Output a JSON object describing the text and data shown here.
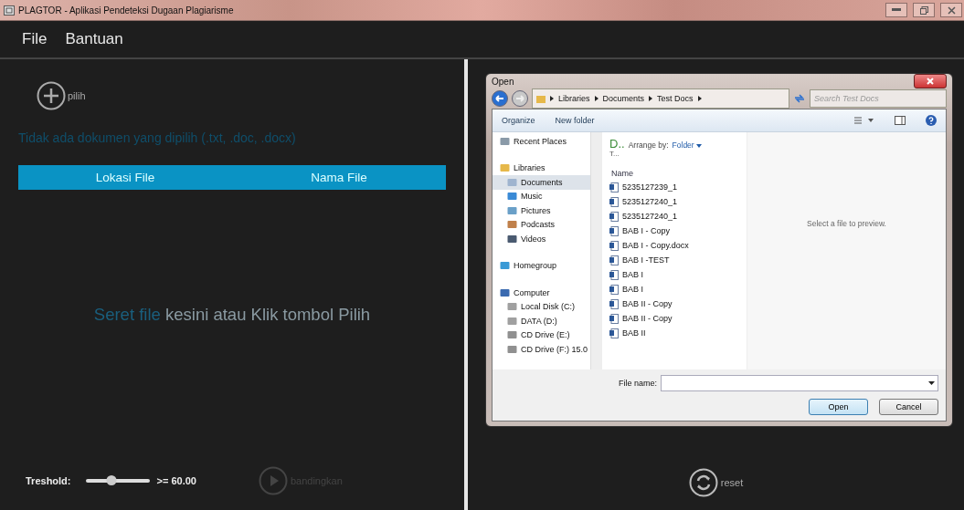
{
  "window": {
    "title": "PLAGTOR - Aplikasi Pendeteksi Dugaan Plagiarisme"
  },
  "menu": [
    "File",
    "Bantuan"
  ],
  "left": {
    "pick_label": "pilih",
    "status": "Tidak ada dokumen yang dipilih (.txt, .doc, .docx)",
    "columns": [
      "Lokasi File",
      "Nama File"
    ],
    "drop_hint": {
      "muted": "Seret file",
      "rest_1": "kesini",
      "rest_2": "atau Klik tombol Pilih"
    },
    "threshold": {
      "label": "Treshold:",
      "level": 0.4,
      "reading": ">= 60.00"
    },
    "compare": {
      "label": "bandingkan",
      "disabled": true
    }
  },
  "right": {
    "reset": {
      "label": "reset"
    }
  },
  "dialog": {
    "title": "Open",
    "path": [
      "Libraries",
      "Documents",
      "Test Docs"
    ],
    "search": {
      "placeholder": "Search Test Docs"
    },
    "toolbar": [
      "Organize",
      "New folder"
    ],
    "nav": [
      {
        "label": "Recent Places",
        "kind": "recent",
        "selected": false
      },
      {
        "label": "Libraries",
        "kind": "libraries",
        "selected": false,
        "children": [
          {
            "label": "Documents",
            "kind": "documents",
            "selected": true
          },
          {
            "label": "Music",
            "kind": "music",
            "selected": false
          },
          {
            "label": "Pictures",
            "kind": "pictures",
            "selected": false
          },
          {
            "label": "Podcasts",
            "kind": "podcasts",
            "selected": false
          },
          {
            "label": "Videos",
            "kind": "videos",
            "selected": false
          }
        ]
      },
      {
        "label": "Homegroup",
        "kind": "homegroup",
        "selected": false
      },
      {
        "label": "Computer",
        "kind": "computer",
        "selected": false,
        "children": [
          {
            "label": "Local Disk (C:)",
            "kind": "disk",
            "selected": false
          },
          {
            "label": "DATA (D:)",
            "kind": "disk",
            "selected": false
          },
          {
            "label": "CD Drive (E:)",
            "kind": "cd",
            "selected": false
          },
          {
            "label": "CD Drive (F:) 15.0",
            "kind": "cd",
            "selected": false
          }
        ]
      }
    ],
    "library_title": "D..",
    "library_sub": "T...",
    "arrange_label": "Arrange by:",
    "arrange_value": "Folder",
    "name_column": "Name",
    "files": [
      "5235127239_1",
      "5235127240_1",
      "5235127240_1",
      "BAB I - Copy",
      "BAB I - Copy.docx",
      "BAB I -TEST",
      "BAB I",
      "BAB I",
      "BAB II - Copy",
      "BAB II - Copy",
      "BAB II"
    ],
    "preview": "Select a file to preview.",
    "filename_label": "File name:",
    "buttons": [
      "Open",
      "Cancel"
    ]
  }
}
